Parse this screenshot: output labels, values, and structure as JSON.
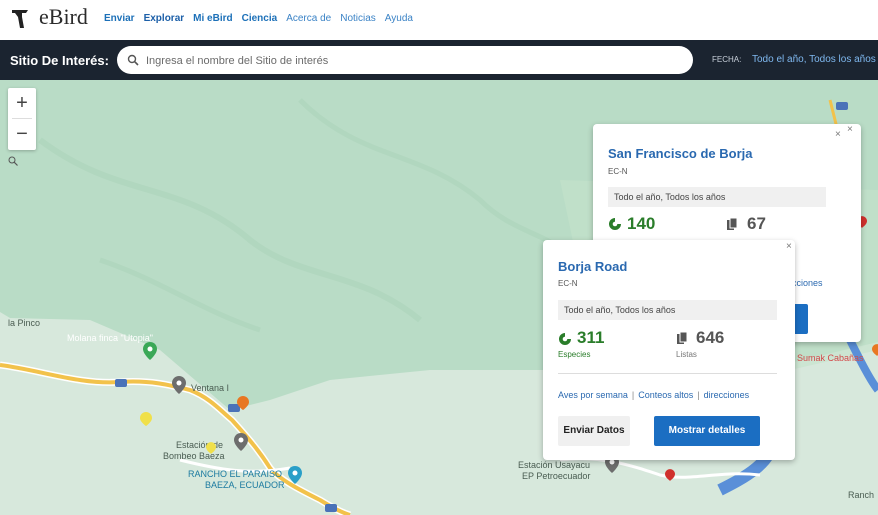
{
  "app": {
    "logo_text": "eBird",
    "nav": [
      {
        "label": "Enviar"
      },
      {
        "label": "Explorar"
      },
      {
        "label": "Mi eBird"
      },
      {
        "label": "Ciencia"
      },
      {
        "label": "Acerca de"
      },
      {
        "label": "Noticias"
      },
      {
        "label": "Ayuda"
      }
    ]
  },
  "search": {
    "label": "Sitio De Interés:",
    "placeholder": "Ingresa el nombre del Sitio de interés",
    "value": "",
    "fecha_label": "FECHA:",
    "fecha_value": "Todo el año, Todos los años"
  },
  "map": {
    "zoom_in": "+",
    "zoom_out": "−",
    "labels": {
      "pinco": "la Pinco",
      "molana": "Molana finca \"Utopia\"",
      "ventana": "Ventana I",
      "estacion_1": "Estación de",
      "estacion_2": "Bombeo Baeza",
      "rancho_1": "RANCHO EL PARAISO",
      "rancho_2": "BAEZA, ECUADOR",
      "usayacu_1": "Estación Usayacu",
      "usayacu_2": "EP Petroecuador",
      "sumak": "Sumak Cabañas",
      "ranch": "Ranch"
    },
    "colors": {
      "water": "#5a8fd8",
      "road": "#f2c24b",
      "forest": "#b9dcc6",
      "valley": "#d7e8dc"
    }
  },
  "popup_back": {
    "title": "San Francisco de Borja",
    "region": "EC-N",
    "date": "Todo el año, Todos los años",
    "species_count": "140",
    "checklists_count": "67",
    "links_tail": "cciones",
    "close": "×"
  },
  "popup_front": {
    "title": "Borja Road",
    "region": "EC-N",
    "date": "Todo el año, Todos los años",
    "species_count": "311",
    "species_label": "Especies",
    "checklists_count": "646",
    "checklists_label": "Listas",
    "links": [
      "Aves por semana",
      "Conteos altos",
      "direcciones"
    ],
    "submit_label": "Enviar Datos",
    "details_label": "Mostrar detalles",
    "close": "×"
  }
}
